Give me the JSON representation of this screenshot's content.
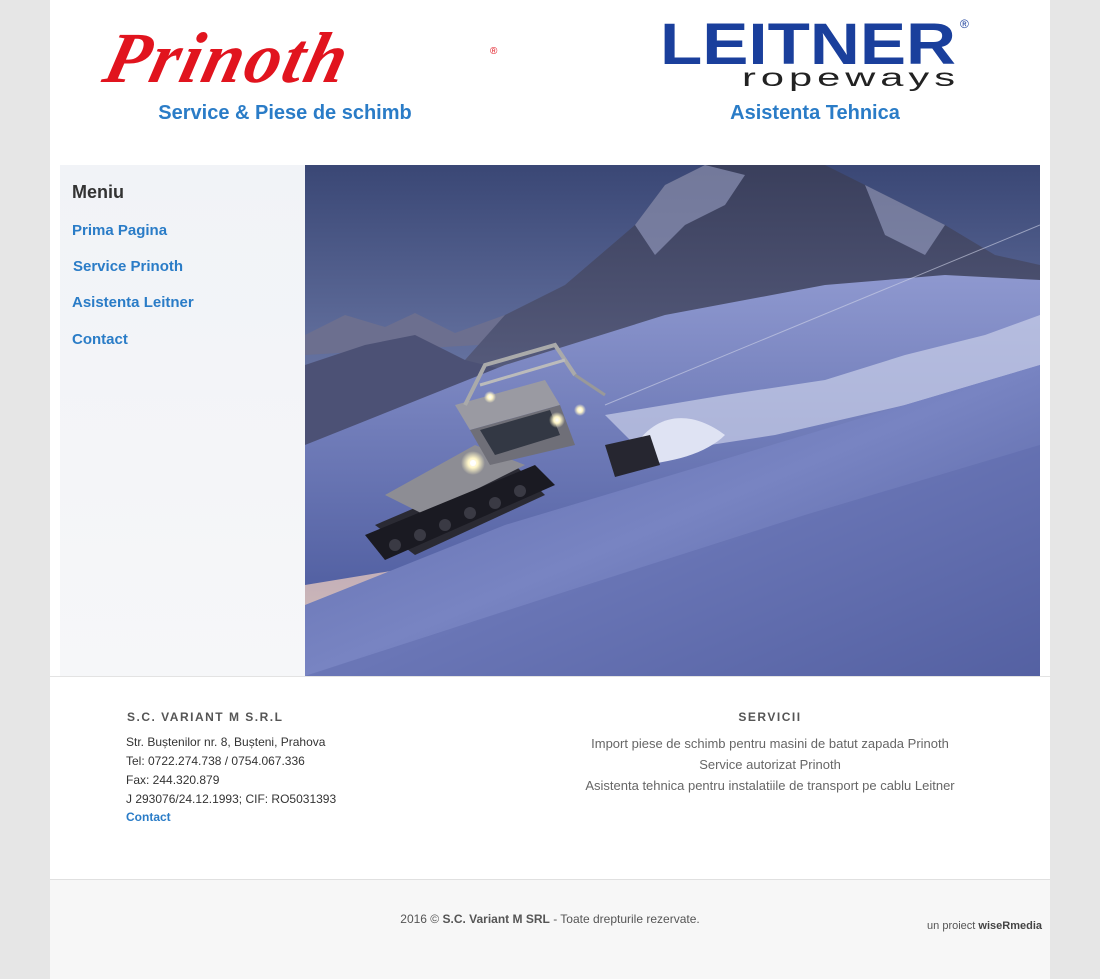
{
  "header": {
    "left_logo": "Prinoth",
    "left_title": "Service & Piese de schimb",
    "right_logo_main": "LEITNER",
    "right_logo_sub": "ropeways",
    "right_title": "Asistenta Tehnica"
  },
  "sidebar": {
    "title": "Meniu",
    "items": [
      {
        "label": "Prima Pagina"
      },
      {
        "label": "Service Prinoth"
      },
      {
        "label": "Asistenta Leitner"
      },
      {
        "label": "Contact"
      }
    ]
  },
  "company": {
    "title": "S.C. VARIANT M S.R.L",
    "lines": [
      "Str. Buștenilor nr. 8, Bușteni, Prahova",
      "Tel: 0722.274.738 / 0754.067.336",
      "Fax: 244.320.879",
      "J 293076/24.12.1993; CIF: RO5031393"
    ],
    "contact_link": "Contact"
  },
  "services": {
    "title": "SERVICII",
    "lines": [
      "Import piese de schimb pentru masini de batut zapada Prinoth",
      "Service autorizat Prinoth",
      "Asistenta tehnica pentru instalatiile de transport pe cablu Leitner"
    ]
  },
  "footer": {
    "year": "2016 ©",
    "company": "S.C. Variant M SRL",
    "rights": "- Toate drepturile rezervate.",
    "credit_prefix": "un proiect",
    "credit_name": "wiseRmedia"
  },
  "colors": {
    "link_blue": "#2a7cc7",
    "prinoth_red": "#e1141e",
    "leitner_blue": "#1a3f9c"
  }
}
